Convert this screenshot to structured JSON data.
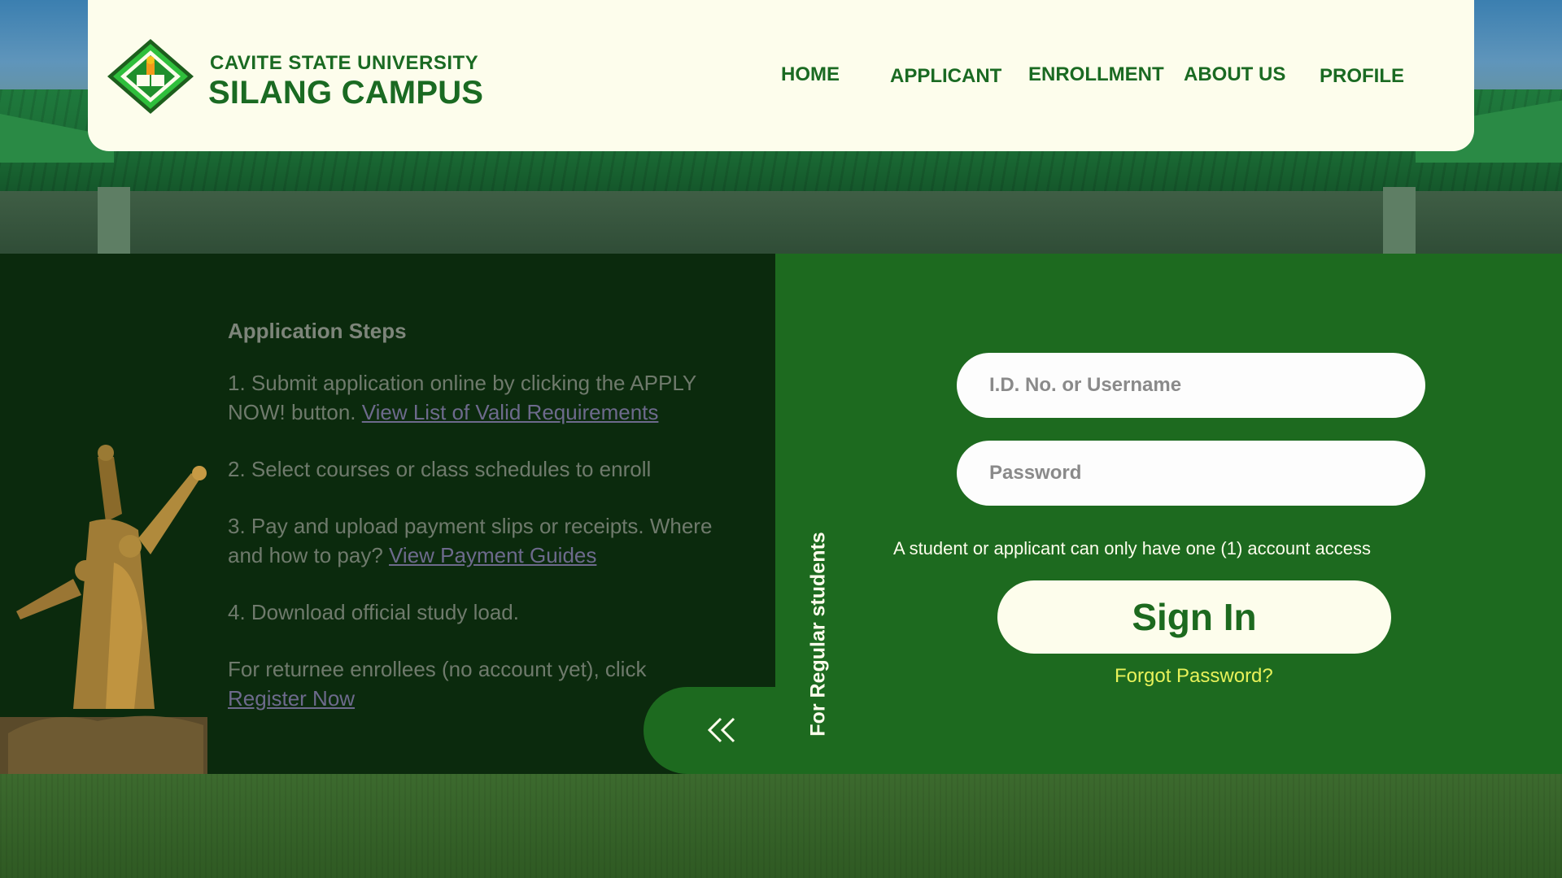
{
  "brand": {
    "university": "CAVITE STATE UNIVERSITY",
    "campus": "SILANG CAMPUS"
  },
  "nav": {
    "items": [
      "HOME",
      "APPLICANT",
      "ENROLLMENT",
      "ABOUT US",
      "PROFILE"
    ]
  },
  "steps": {
    "title": "Application Steps",
    "step1_text": "1. Submit application online by clicking the APPLY NOW! button.",
    "step1_link": "View List of Valid Requirements",
    "step2_text": "2. Select courses or class schedules to enroll",
    "step3_text": "3. Pay and upload payment slips or receipts. Where and how to pay?",
    "step3_link": "View Payment Guides",
    "step4_text": "4. Download official study load.",
    "step5_text": "For returnee enrollees (no account yet), click",
    "step5_link": "Register Now"
  },
  "login": {
    "side_label": "For Regular students",
    "username_placeholder": "I.D. No. or Username",
    "password_placeholder": "Password",
    "notice": "A student or applicant can only have one (1) account access",
    "signin_label": "Sign In",
    "forgot_label": "Forgot Password?"
  },
  "colors": {
    "brand_green": "#1a6a22",
    "panel_green": "#1d6a1f",
    "header_bg": "#fdfdec",
    "forgot_link": "#e8f25a"
  },
  "icons": {
    "logo": "cvsu-seal",
    "collapse": "double-chevron-left-icon"
  }
}
